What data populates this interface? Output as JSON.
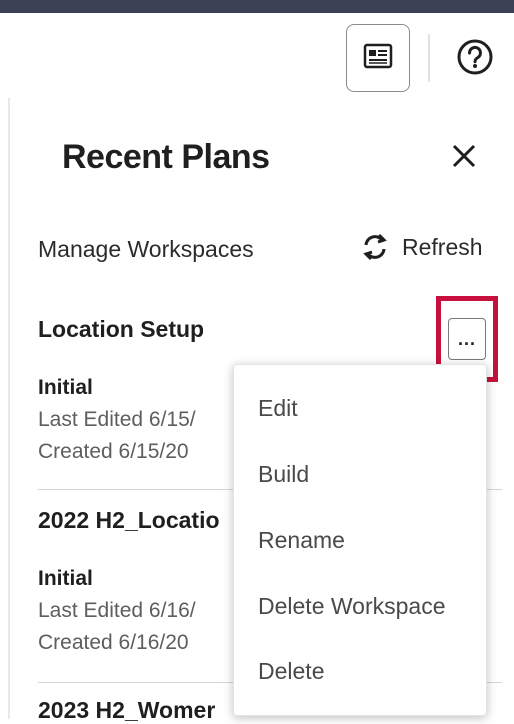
{
  "header": {
    "toolbar_icon": "card-view-icon",
    "help_icon": "help-circle-icon"
  },
  "panel": {
    "title": "Recent Plans",
    "close_icon": "close-icon",
    "manage_label": "Manage Workspaces",
    "refresh_label": "Refresh",
    "refresh_icon": "refresh-icon"
  },
  "workspaces": [
    {
      "name": "Location Setup",
      "plan": "Initial",
      "last_edited": "Last Edited 6/15/",
      "created": "Created 6/15/20"
    },
    {
      "name": "2022 H2_Locatio",
      "plan": "Initial",
      "last_edited": "Last Edited 6/16/",
      "created": "Created 6/16/20"
    },
    {
      "name": "2023 H2_Womer"
    }
  ],
  "more_button": {
    "label": "...",
    "highlight_color": "#c8103e"
  },
  "context_menu": {
    "items": [
      "Edit",
      "Build",
      "Rename",
      "Delete Workspace",
      "Delete"
    ]
  }
}
